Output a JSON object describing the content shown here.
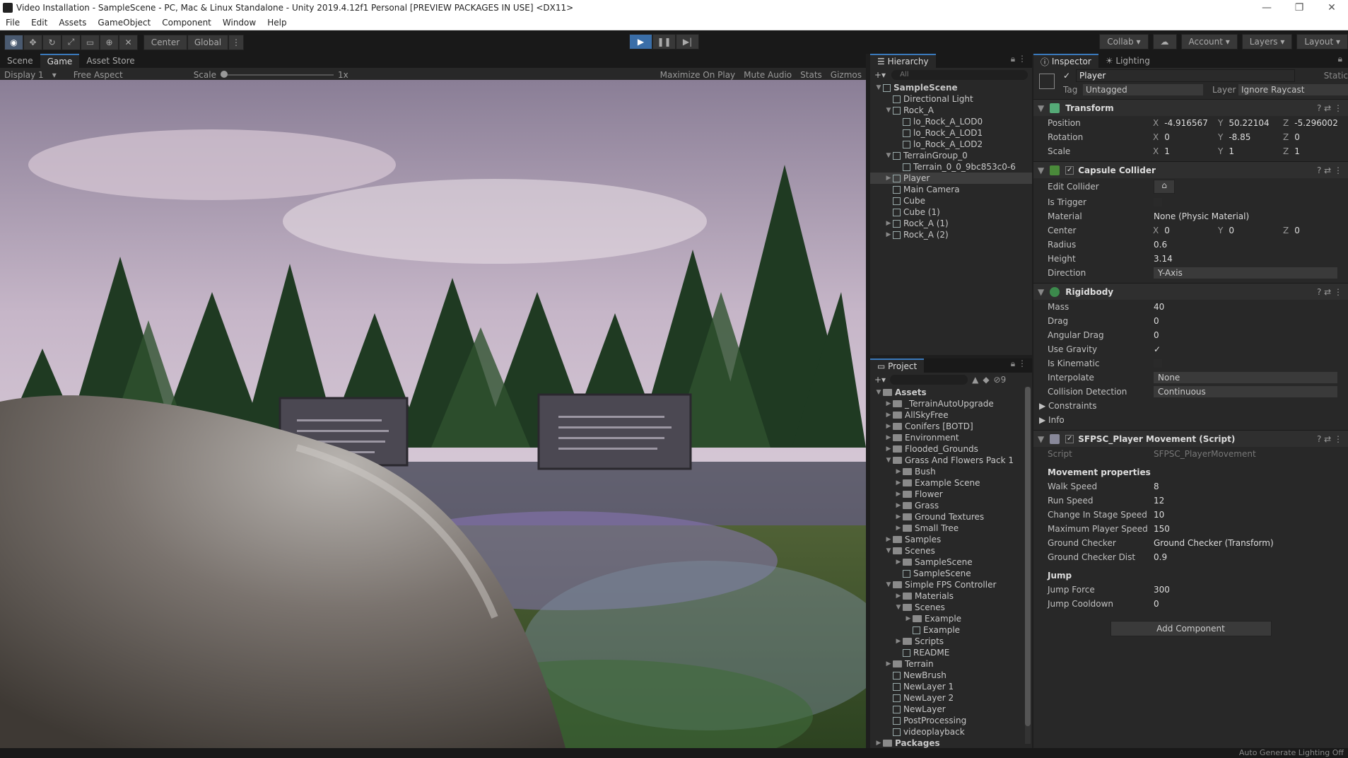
{
  "window": {
    "title": "Video Installation - SampleScene - PC, Mac & Linux Standalone - Unity 2019.4.12f1 Personal [PREVIEW PACKAGES IN USE] <DX11>"
  },
  "menu": [
    "File",
    "Edit",
    "Assets",
    "GameObject",
    "Component",
    "Window",
    "Help"
  ],
  "toolbar": {
    "center": "Center",
    "global": "Global",
    "collab": "Collab",
    "account": "Account",
    "layers": "Layers",
    "layout": "Layout"
  },
  "scene_tabs": [
    "Scene",
    "Game",
    "Asset Store"
  ],
  "gamebar": {
    "display": "Display 1",
    "aspect": "Free Aspect",
    "scale_label": "Scale",
    "scale_value": "1x",
    "maximize": "Maximize On Play",
    "mute": "Mute Audio",
    "stats": "Stats",
    "gizmos": "Gizmos"
  },
  "hierarchy": {
    "title": "Hierarchy",
    "search": "All",
    "items": [
      {
        "label": "SampleScene",
        "depth": 0,
        "exp": "▼",
        "bold": true
      },
      {
        "label": "Directional Light",
        "depth": 1,
        "exp": ""
      },
      {
        "label": "Rock_A",
        "depth": 1,
        "exp": "▼"
      },
      {
        "label": "lo_Rock_A_LOD0",
        "depth": 2,
        "exp": ""
      },
      {
        "label": "lo_Rock_A_LOD1",
        "depth": 2,
        "exp": ""
      },
      {
        "label": "lo_Rock_A_LOD2",
        "depth": 2,
        "exp": ""
      },
      {
        "label": "TerrainGroup_0",
        "depth": 1,
        "exp": "▼"
      },
      {
        "label": "Terrain_0_0_9bc853c0-6",
        "depth": 2,
        "exp": ""
      },
      {
        "label": "Player",
        "depth": 1,
        "exp": "▶",
        "selected": true
      },
      {
        "label": "Main Camera",
        "depth": 1,
        "exp": ""
      },
      {
        "label": "Cube",
        "depth": 1,
        "exp": ""
      },
      {
        "label": "Cube (1)",
        "depth": 1,
        "exp": ""
      },
      {
        "label": "Rock_A (1)",
        "depth": 1,
        "exp": "▶"
      },
      {
        "label": "Rock_A (2)",
        "depth": 1,
        "exp": "▶"
      }
    ]
  },
  "project": {
    "title": "Project",
    "count": "9",
    "items": [
      {
        "label": "Assets",
        "depth": 0,
        "exp": "▼",
        "bold": true
      },
      {
        "label": "_TerrainAutoUpgrade",
        "depth": 1,
        "exp": "▶"
      },
      {
        "label": "AllSkyFree",
        "depth": 1,
        "exp": "▶"
      },
      {
        "label": "Conifers [BOTD]",
        "depth": 1,
        "exp": "▶"
      },
      {
        "label": "Environment",
        "depth": 1,
        "exp": "▶"
      },
      {
        "label": "Flooded_Grounds",
        "depth": 1,
        "exp": "▶"
      },
      {
        "label": "Grass And Flowers Pack 1",
        "depth": 1,
        "exp": "▼"
      },
      {
        "label": "Bush",
        "depth": 2,
        "exp": "▶"
      },
      {
        "label": "Example Scene",
        "depth": 2,
        "exp": "▶"
      },
      {
        "label": "Flower",
        "depth": 2,
        "exp": "▶"
      },
      {
        "label": "Grass",
        "depth": 2,
        "exp": "▶"
      },
      {
        "label": "Ground Textures",
        "depth": 2,
        "exp": "▶"
      },
      {
        "label": "Small Tree",
        "depth": 2,
        "exp": "▶"
      },
      {
        "label": "Samples",
        "depth": 1,
        "exp": "▶"
      },
      {
        "label": "Scenes",
        "depth": 1,
        "exp": "▼"
      },
      {
        "label": "SampleScene",
        "depth": 2,
        "exp": "▶"
      },
      {
        "label": "SampleScene",
        "depth": 2,
        "exp": "",
        "scene": true
      },
      {
        "label": "Simple FPS Controller",
        "depth": 1,
        "exp": "▼"
      },
      {
        "label": "Materials",
        "depth": 2,
        "exp": "▶"
      },
      {
        "label": "Scenes",
        "depth": 2,
        "exp": "▼"
      },
      {
        "label": "Example",
        "depth": 3,
        "exp": "▶"
      },
      {
        "label": "Example",
        "depth": 3,
        "exp": "",
        "scene": true
      },
      {
        "label": "Scripts",
        "depth": 2,
        "exp": "▶"
      },
      {
        "label": "README",
        "depth": 2,
        "exp": "",
        "scene": true
      },
      {
        "label": "Terrain",
        "depth": 1,
        "exp": "▶"
      },
      {
        "label": "NewBrush",
        "depth": 1,
        "exp": "",
        "scene": true
      },
      {
        "label": "NewLayer 1",
        "depth": 1,
        "exp": "",
        "scene": true
      },
      {
        "label": "NewLayer 2",
        "depth": 1,
        "exp": "",
        "scene": true
      },
      {
        "label": "NewLayer",
        "depth": 1,
        "exp": "",
        "scene": true
      },
      {
        "label": "PostProcessing",
        "depth": 1,
        "exp": "",
        "scene": true
      },
      {
        "label": "videoplayback",
        "depth": 1,
        "exp": "",
        "scene": true
      },
      {
        "label": "Packages",
        "depth": 0,
        "exp": "▶",
        "bold": true
      }
    ]
  },
  "inspector": {
    "tabs": [
      "Inspector",
      "Lighting"
    ],
    "object_name": "Player",
    "static": "Static",
    "tag_label": "Tag",
    "tag_value": "Untagged",
    "layer_label": "Layer",
    "layer_value": "Ignore Raycast",
    "transform": {
      "title": "Transform",
      "position": {
        "label": "Position",
        "x": "-4.916567",
        "y": "50.22104",
        "z": "-5.296002"
      },
      "rotation": {
        "label": "Rotation",
        "x": "0",
        "y": "-8.85",
        "z": "0"
      },
      "scale": {
        "label": "Scale",
        "x": "1",
        "y": "1",
        "z": "1"
      }
    },
    "capsule": {
      "title": "Capsule Collider",
      "edit_collider": "Edit Collider",
      "is_trigger": "Is Trigger",
      "material_label": "Material",
      "material_value": "None (Physic Material)",
      "center": {
        "label": "Center",
        "x": "0",
        "y": "0",
        "z": "0"
      },
      "radius_label": "Radius",
      "radius": "0.6",
      "height_label": "Height",
      "height": "3.14",
      "direction_label": "Direction",
      "direction": "Y-Axis"
    },
    "rigidbody": {
      "title": "Rigidbody",
      "mass_label": "Mass",
      "mass": "40",
      "drag_label": "Drag",
      "drag": "0",
      "angular_label": "Angular Drag",
      "angular": "0",
      "gravity_label": "Use Gravity",
      "gravity": "✓",
      "kinematic_label": "Is Kinematic",
      "interp_label": "Interpolate",
      "interp": "None",
      "collision_label": "Collision Detection",
      "collision": "Continuous",
      "constraints": "Constraints",
      "info": "Info"
    },
    "script": {
      "title": "SFPSC_Player Movement (Script)",
      "script_label": "Script",
      "script_value": "SFPSC_PlayerMovement",
      "movement_header": "Movement properties",
      "walk_label": "Walk Speed",
      "walk": "8",
      "run_label": "Run Speed",
      "run": "12",
      "change_label": "Change In Stage Speed",
      "change": "10",
      "max_label": "Maximum Player Speed",
      "max": "150",
      "checker_label": "Ground Checker",
      "checker": "Ground Checker (Transform)",
      "checker_dist_label": "Ground Checker Dist",
      "checker_dist": "0.9",
      "jump_header": "Jump",
      "jump_force_label": "Jump Force",
      "jump_force": "300",
      "jump_cd_label": "Jump Cooldown",
      "jump_cd": "0"
    },
    "add_component": "Add Component"
  },
  "status": {
    "text": "Auto Generate Lighting Off"
  },
  "colors": {
    "accent": "#3a79bb",
    "play_active": "#3a6ea8",
    "panel": "#282828"
  }
}
